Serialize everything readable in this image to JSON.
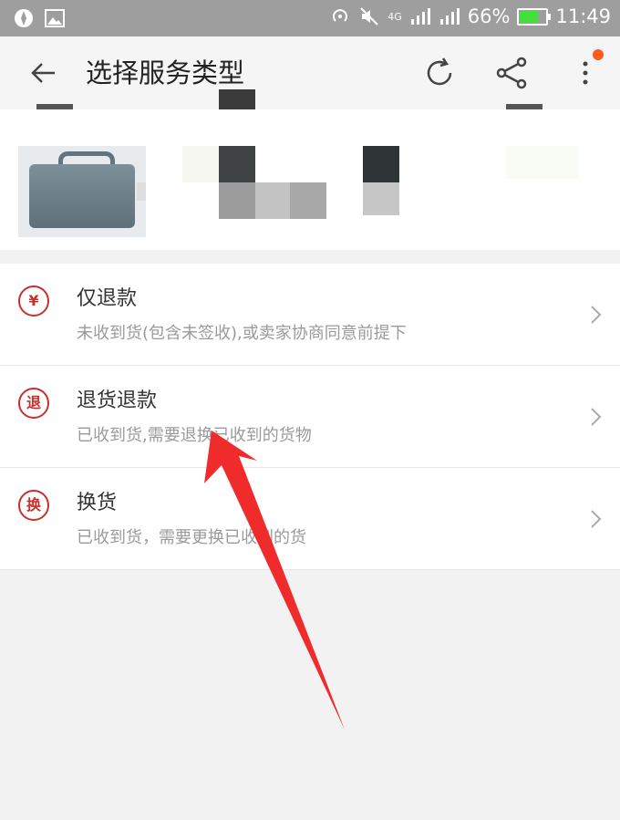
{
  "status_bar": {
    "battery": "66%",
    "time": "11:49",
    "network": "4G"
  },
  "toolbar": {
    "title": "选择服务类型"
  },
  "service_options": [
    {
      "icon_label": "¥",
      "title": "仅退款",
      "description": "未收到货(包含未签收),或卖家协商同意前提下"
    },
    {
      "icon_label": "退",
      "title": "退货退款",
      "description": "已收到货,需要退换已收到的货物"
    },
    {
      "icon_label": "换",
      "title": "换货",
      "description": "已收到货，需要更换已收到的货"
    }
  ],
  "colors": {
    "accent": "#c9302c",
    "annotation_arrow": "#f02b2b",
    "notification_dot": "#ff5a1f"
  }
}
